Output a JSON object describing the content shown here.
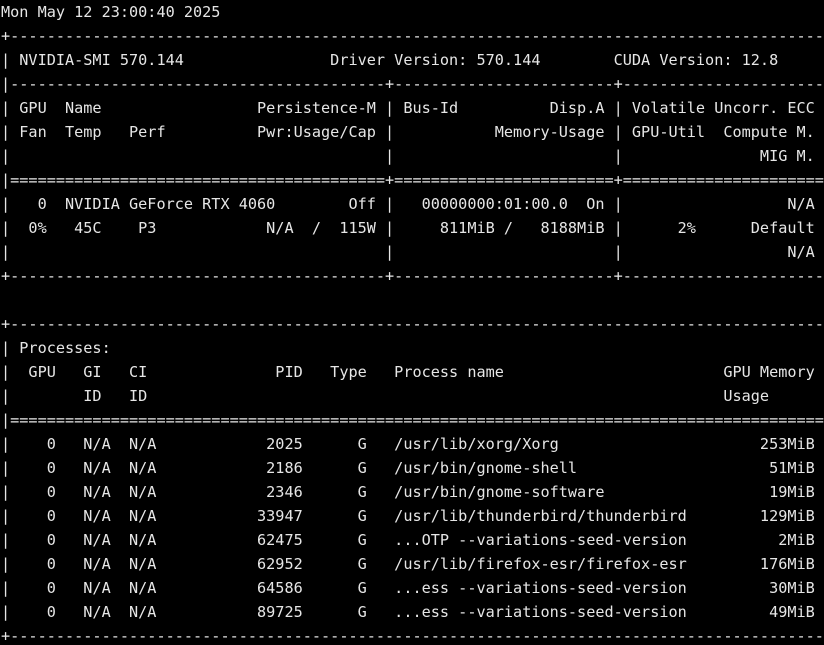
{
  "terminal": {
    "lines": [
      "Mon May 12 23:00:40 2025",
      "+-----------------------------------------------------------------------------------------+",
      "| NVIDIA-SMI 570.144                Driver Version: 570.144        CUDA Version: 12.8     |",
      "|-----------------------------------------+------------------------+----------------------+",
      "| GPU  Name                 Persistence-M | Bus-Id          Disp.A | Volatile Uncorr. ECC |",
      "| Fan  Temp   Perf          Pwr:Usage/Cap |           Memory-Usage | GPU-Util  Compute M. |",
      "|                                         |                        |               MIG M. |",
      "|=========================================+========================+======================|",
      "|   0  NVIDIA GeForce RTX 4060        Off |   00000000:01:00.0  On |                  N/A |",
      "|  0%   45C    P3            N/A  /  115W |     811MiB /   8188MiB |      2%      Default |",
      "|                                         |                        |                  N/A |",
      "+-----------------------------------------+------------------------+----------------------+",
      "",
      "+-----------------------------------------------------------------------------------------+",
      "| Processes:                                                                              |",
      "|  GPU   GI   CI              PID   Type   Process name                        GPU Memory |",
      "|        ID   ID                                                               Usage      |",
      "|=========================================================================================|",
      "|    0   N/A  N/A            2025      G   /usr/lib/xorg/Xorg                      253MiB |",
      "|    0   N/A  N/A            2186      G   /usr/bin/gnome-shell                     51MiB |",
      "|    0   N/A  N/A            2346      G   /usr/bin/gnome-software                  19MiB |",
      "|    0   N/A  N/A           33947      G   /usr/lib/thunderbird/thunderbird        129MiB |",
      "|    0   N/A  N/A           62475      G   ...OTP --variations-seed-version          2MiB |",
      "|    0   N/A  N/A           62952      G   /usr/lib/firefox-esr/firefox-esr        176MiB |",
      "|    0   N/A  N/A           64586      G   ...ess --variations-seed-version         30MiB |",
      "|    0   N/A  N/A           89725      G   ...ess --variations-seed-version         49MiB |",
      "+-----------------------------------------------------------------------------------------+"
    ]
  }
}
